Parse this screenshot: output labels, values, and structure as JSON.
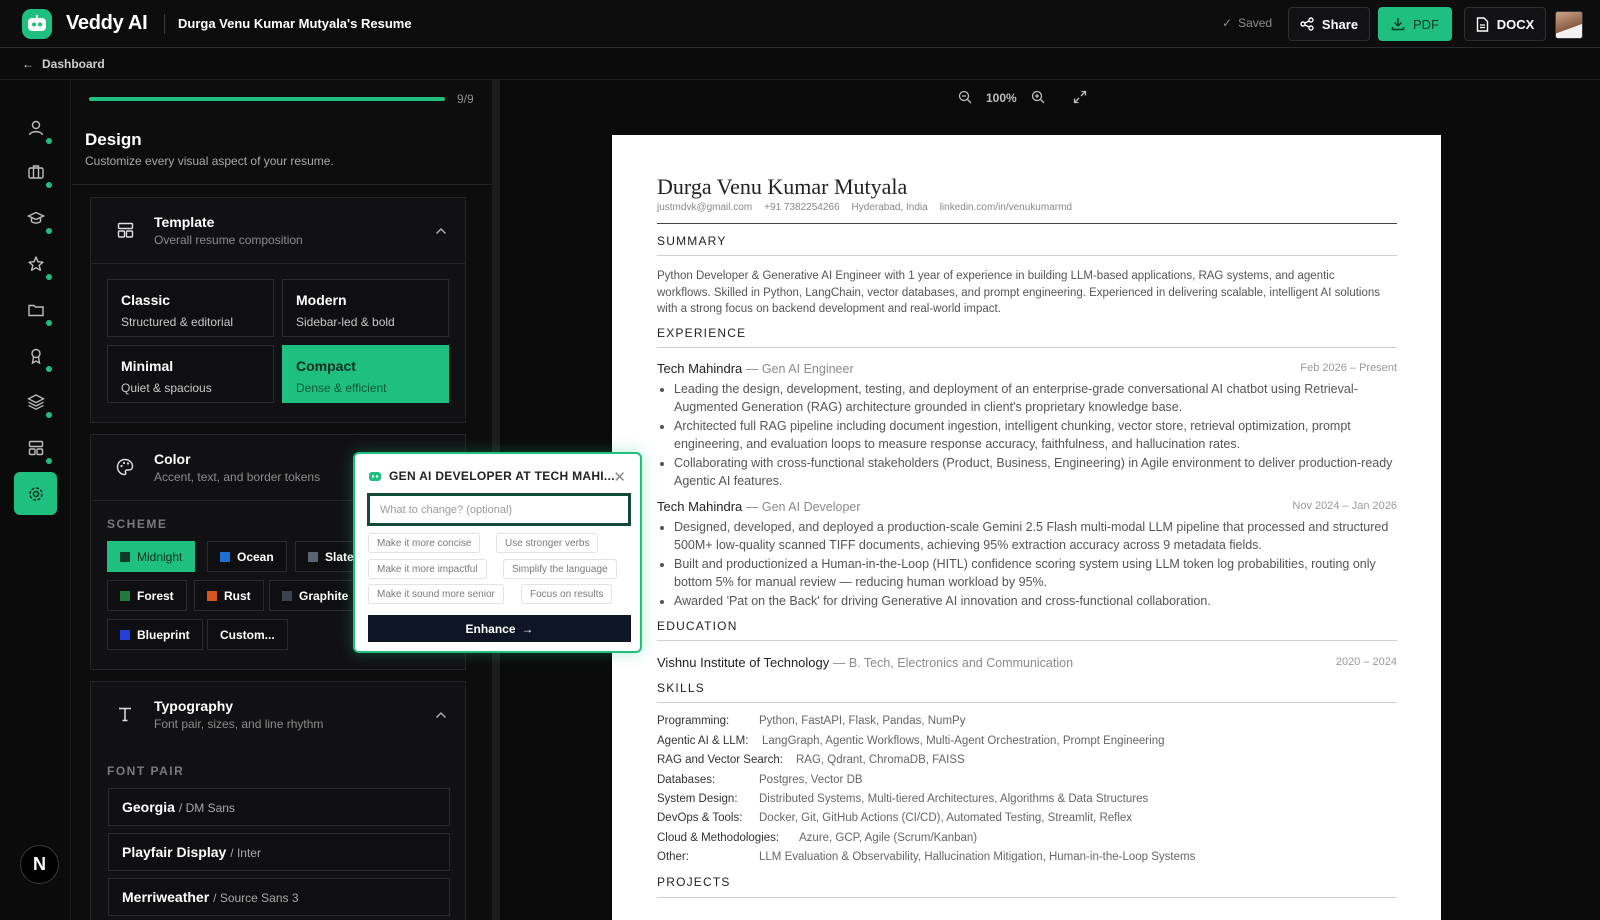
{
  "header": {
    "brand": "Veddy AI",
    "doc_title": "Durga Venu Kumar Mutyala's Resume",
    "saved": "Saved",
    "share": "Share",
    "pdf": "PDF",
    "docx": "DOCX"
  },
  "subbar": {
    "back": "Dashboard"
  },
  "rail": {
    "bottom_badge": "N"
  },
  "panel": {
    "progress_value": 1.0,
    "progress_label": "9/9",
    "title": "Design",
    "subtitle": "Customize every visual aspect of your resume.",
    "template": {
      "title": "Template",
      "subtitle": "Overall resume composition",
      "options": [
        {
          "name": "Classic",
          "desc": "Structured & editorial"
        },
        {
          "name": "Modern",
          "desc": "Sidebar-led & bold"
        },
        {
          "name": "Minimal",
          "desc": "Quiet & spacious"
        },
        {
          "name": "Compact",
          "desc": "Dense & efficient"
        }
      ],
      "selected": "Compact"
    },
    "color": {
      "title": "Color",
      "subtitle": "Accent, text, and border tokens",
      "scheme_label": "SCHEME",
      "schemes": [
        {
          "name": "Midnight",
          "swatch": "#0f3b2a"
        },
        {
          "name": "Ocean",
          "swatch": "#1d6fd1"
        },
        {
          "name": "Slate",
          "swatch": "#5b6273"
        },
        {
          "name": "Forest",
          "swatch": "#1f7a3f"
        },
        {
          "name": "Rust",
          "swatch": "#d4561c"
        },
        {
          "name": "Graphite",
          "swatch": "#3c4150"
        },
        {
          "name": "Blueprint",
          "swatch": "#2540d8"
        }
      ],
      "custom": "Custom...",
      "selected": "Midnight"
    },
    "typography": {
      "title": "Typography",
      "subtitle": "Font pair, sizes, and line rhythm",
      "font_pair_label": "FONT PAIR",
      "pairs": [
        {
          "display": "Georgia",
          "body": "/ DM Sans"
        },
        {
          "display": "Playfair Display",
          "body": "/ Inter"
        },
        {
          "display": "Merriweather",
          "body": "/ Source Sans 3"
        }
      ]
    }
  },
  "popup": {
    "title": "GEN AI DEVELOPER AT TECH MAHI...",
    "placeholder": "What to change? (optional)",
    "suggestions": [
      "Make it more concise",
      "Use stronger verbs",
      "Make it more impactful",
      "Simplify the language",
      "Make it sound more senior",
      "Focus on results"
    ],
    "enhance": "Enhance"
  },
  "zoom": {
    "level": "100%"
  },
  "resume": {
    "name": "Durga Venu Kumar Mutyala",
    "contact": [
      "justmdvk@gmail.com",
      "+91 7382254266",
      "Hyderabad, India",
      "linkedin.com/in/venukumarmd"
    ],
    "summary_h": "SUMMARY",
    "summary": "Python Developer & Generative AI Engineer with 1 year of experience in building LLM-based applications, RAG systems, and agentic workflows. Skilled in Python, LangChain, vector databases, and prompt engineering. Experienced in delivering scalable, intelligent AI solutions with a strong focus on backend development and real-world impact.",
    "experience_h": "EXPERIENCE",
    "jobs": [
      {
        "company": "Tech Mahindra",
        "role": "— Gen AI Engineer",
        "date": "Feb 2026 – Present",
        "bullets": [
          "Leading the design, development, testing, and deployment of an enterprise-grade conversational AI chatbot using Retrieval-Augmented Generation (RAG) architecture grounded in client's proprietary knowledge base.",
          "Architected full RAG pipeline including document ingestion, intelligent chunking, vector store, retrieval optimization, prompt engineering, and evaluation loops to measure response accuracy, faithfulness, and hallucination rates.",
          "Collaborating with cross-functional stakeholders (Product, Business, Engineering) in Agile environment to deliver production-ready Agentic AI features."
        ]
      },
      {
        "company": "Tech Mahindra",
        "role": "— Gen AI Developer",
        "date": "Nov 2024 – Jan 2026",
        "bullets": [
          "Designed, developed, and deployed a production-scale Gemini 2.5 Flash multi-modal LLM pipeline that processed and structured 500M+ low-quality scanned TIFF documents, achieving 95% extraction accuracy across 9 metadata fields.",
          "Built and productionized a Human-in-the-Loop (HITL) confidence scoring system using LLM token log probabilities, routing only bottom 5% for manual review — reducing human workload by 95%.",
          "Awarded 'Pat on the Back' for driving Generative AI innovation and cross-functional collaboration."
        ]
      }
    ],
    "education_h": "EDUCATION",
    "education": {
      "school": "Vishnu Institute of Technology",
      "degree": "— B. Tech, Electronics and Communication",
      "date": "2020 – 2024"
    },
    "skills_h": "SKILLS",
    "skills": [
      {
        "k": "Programming:",
        "v": "Python, FastAPI, Flask, Pandas, NumPy"
      },
      {
        "k": "Agentic AI & LLM:",
        "v": "LangGraph, Agentic Workflows, Multi-Agent Orchestration, Prompt Engineering"
      },
      {
        "k": "RAG and Vector Search:",
        "v": "RAG, Qdrant, ChromaDB, FAISS"
      },
      {
        "k": "Databases:",
        "v": "Postgres, Vector DB"
      },
      {
        "k": "System Design:",
        "v": "Distributed Systems, Multi-tiered Architectures, Algorithms & Data Structures"
      },
      {
        "k": "DevOps & Tools:",
        "v": "Docker, Git, GitHub Actions (CI/CD), Automated Testing, Streamlit, Reflex"
      },
      {
        "k": "Cloud & Methodologies:",
        "v": "Azure, GCP, Agile (Scrum/Kanban)"
      },
      {
        "k": "Other:",
        "v": "LLM Evaluation & Observability, Hallucination Mitigation, Human-in-the-Loop Systems"
      }
    ],
    "projects_h": "PROJECTS"
  },
  "colors": {
    "accent": "#1fbf7f",
    "bg": "#0b0b0c"
  }
}
